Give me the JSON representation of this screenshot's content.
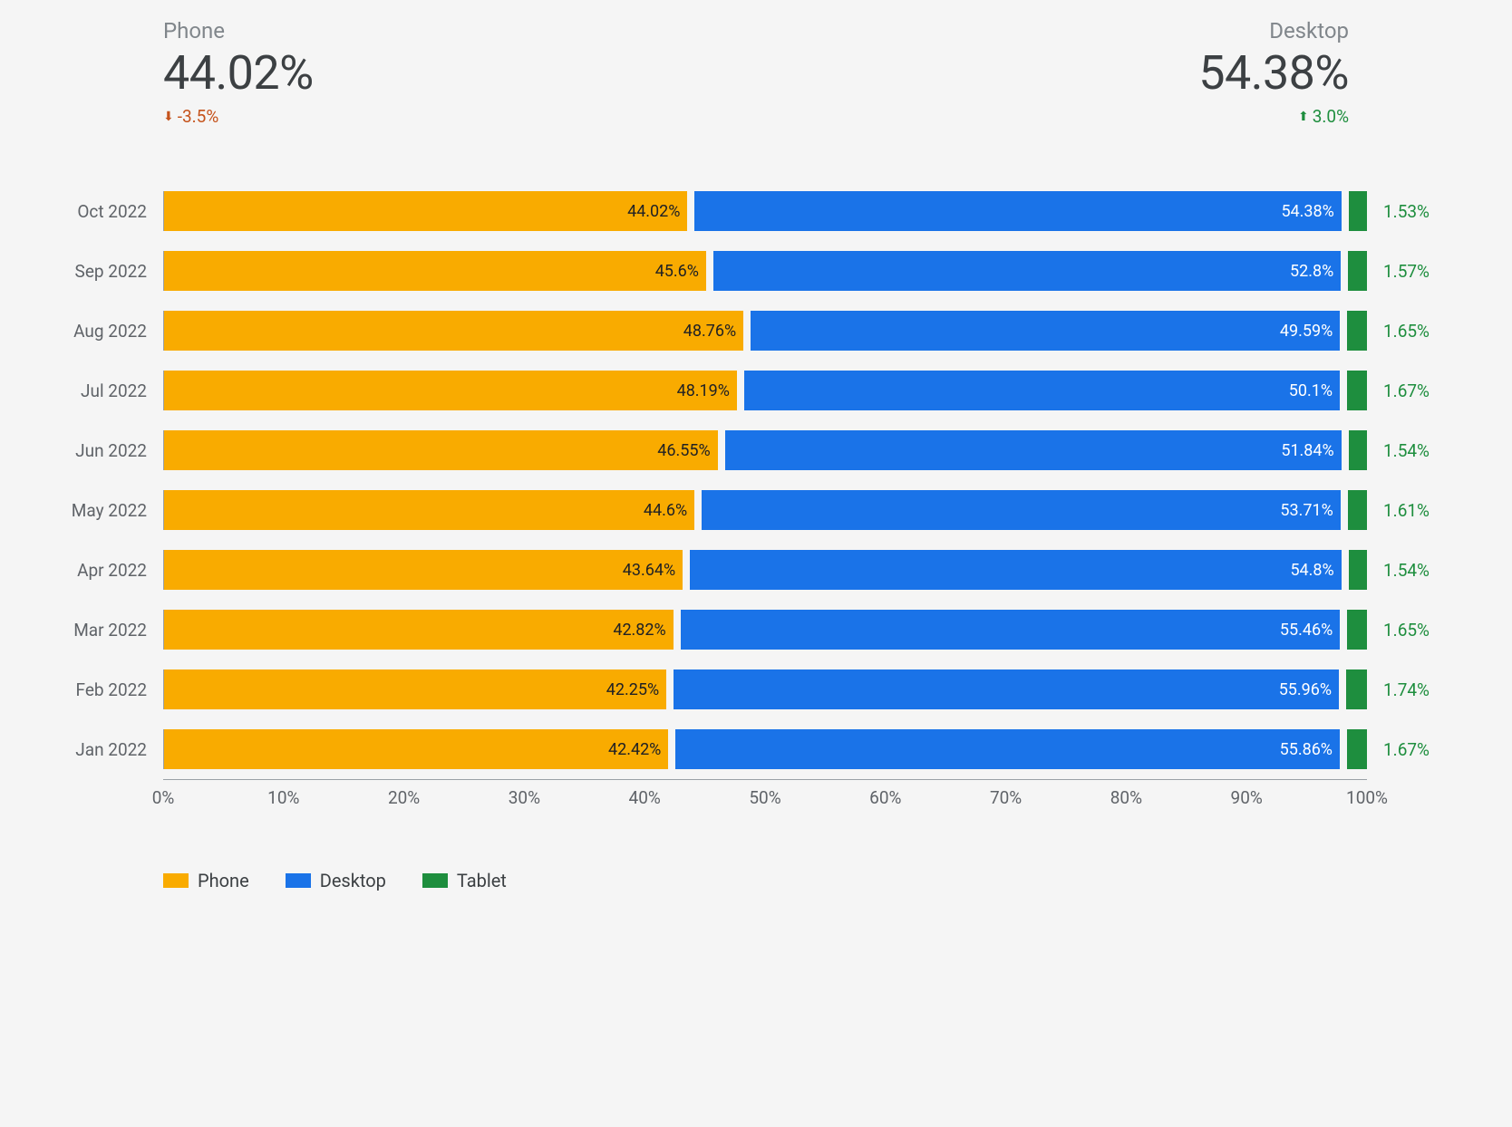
{
  "kpi": {
    "phone": {
      "label": "Phone",
      "value": "44.02%",
      "delta": "-3.5%",
      "direction": "down"
    },
    "desktop": {
      "label": "Desktop",
      "value": "54.38%",
      "delta": "3.0%",
      "direction": "up"
    }
  },
  "legend": {
    "phone": "Phone",
    "desktop": "Desktop",
    "tablet": "Tablet"
  },
  "axis_ticks": [
    "0%",
    "10%",
    "20%",
    "30%",
    "40%",
    "50%",
    "60%",
    "70%",
    "80%",
    "90%",
    "100%"
  ],
  "chart_data": {
    "type": "bar",
    "orientation": "horizontal-stacked",
    "xlabel": "",
    "ylabel": "",
    "xlim": [
      0,
      100
    ],
    "categories": [
      "Oct 2022",
      "Sep 2022",
      "Aug 2022",
      "Jul 2022",
      "Jun 2022",
      "May 2022",
      "Apr 2022",
      "Mar 2022",
      "Feb 2022",
      "Jan 2022"
    ],
    "series": [
      {
        "name": "Phone",
        "color": "#f9ab00",
        "values": [
          44.02,
          45.6,
          48.76,
          48.19,
          46.55,
          44.6,
          43.64,
          42.82,
          42.25,
          42.42
        ]
      },
      {
        "name": "Desktop",
        "color": "#1a73e8",
        "values": [
          54.38,
          52.8,
          49.59,
          50.1,
          51.84,
          53.71,
          54.8,
          55.46,
          55.96,
          55.86
        ]
      },
      {
        "name": "Tablet",
        "color": "#1e8e3e",
        "values": [
          1.53,
          1.57,
          1.65,
          1.67,
          1.54,
          1.61,
          1.54,
          1.65,
          1.74,
          1.67
        ]
      }
    ],
    "value_labels": {
      "phone": [
        "44.02%",
        "45.6%",
        "48.76%",
        "48.19%",
        "46.55%",
        "44.6%",
        "43.64%",
        "42.82%",
        "42.25%",
        "42.42%"
      ],
      "desktop": [
        "54.38%",
        "52.8%",
        "49.59%",
        "50.1%",
        "51.84%",
        "53.71%",
        "54.8%",
        "55.46%",
        "55.96%",
        "55.86%"
      ],
      "tablet": [
        "1.53%",
        "1.57%",
        "1.65%",
        "1.67%",
        "1.54%",
        "1.61%",
        "1.54%",
        "1.65%",
        "1.74%",
        "1.67%"
      ]
    }
  }
}
